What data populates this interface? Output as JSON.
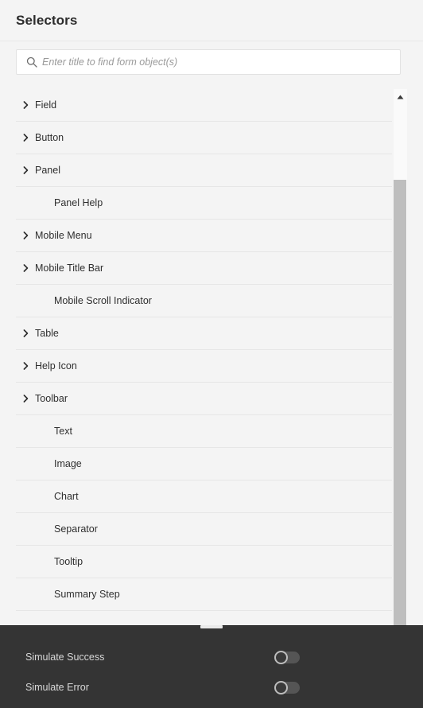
{
  "header": {
    "title": "Selectors"
  },
  "search": {
    "icon": "search-icon",
    "placeholder": "Enter title to find form object(s)",
    "value": ""
  },
  "list": {
    "items": [
      {
        "label": "Field",
        "expandable": true,
        "icon": "chevron-right-icon"
      },
      {
        "label": "Button",
        "expandable": true,
        "icon": "chevron-right-icon"
      },
      {
        "label": "Panel",
        "expandable": true,
        "icon": "chevron-right-icon"
      },
      {
        "label": "Panel Help",
        "expandable": false,
        "icon": ""
      },
      {
        "label": "Mobile Menu",
        "expandable": true,
        "icon": "chevron-right-icon"
      },
      {
        "label": "Mobile Title Bar",
        "expandable": true,
        "icon": "chevron-right-icon"
      },
      {
        "label": "Mobile Scroll Indicator",
        "expandable": false,
        "icon": ""
      },
      {
        "label": "Table",
        "expandable": true,
        "icon": "chevron-right-icon"
      },
      {
        "label": "Help Icon",
        "expandable": true,
        "icon": "chevron-right-icon"
      },
      {
        "label": "Toolbar",
        "expandable": true,
        "icon": "chevron-right-icon"
      },
      {
        "label": "Text",
        "expandable": false,
        "icon": ""
      },
      {
        "label": "Image",
        "expandable": false,
        "icon": ""
      },
      {
        "label": "Chart",
        "expandable": false,
        "icon": ""
      },
      {
        "label": "Separator",
        "expandable": false,
        "icon": ""
      },
      {
        "label": "Tooltip",
        "expandable": false,
        "icon": ""
      },
      {
        "label": "Summary Step",
        "expandable": false,
        "icon": ""
      }
    ]
  },
  "scrollbar": {
    "up_arrow_icon": "caret-up-icon"
  },
  "simulate_panel": {
    "rows": [
      {
        "label": "Simulate Success",
        "state": "off"
      },
      {
        "label": "Simulate Error",
        "state": "off"
      }
    ]
  },
  "colors": {
    "panel_background": "#f4f4f4",
    "row_divider": "#e6e6e6",
    "text_primary": "#2f2f2f",
    "placeholder": "#9a9a9a",
    "dark_panel": "#343434",
    "dark_panel_text": "#d8d8d8",
    "scroll_thumb": "#bebebe"
  }
}
